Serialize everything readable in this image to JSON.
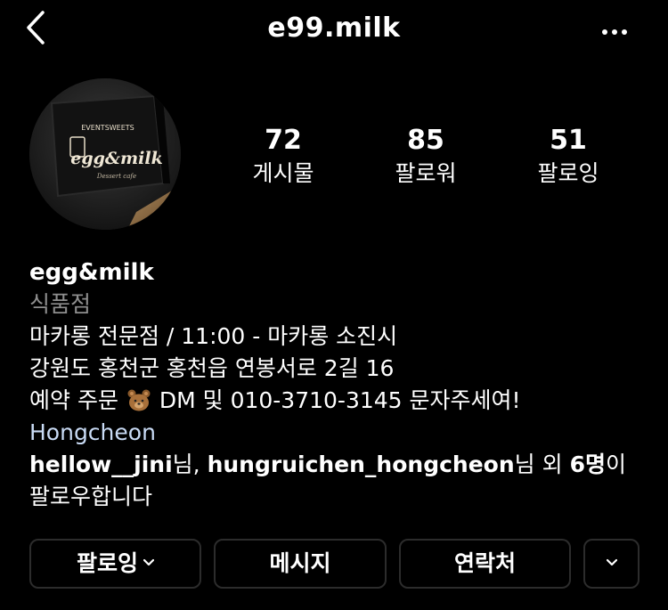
{
  "header": {
    "username": "e99.milk"
  },
  "avatar": {
    "sign_top": "EVENTSWEETS",
    "sign_brand": "egg&milk",
    "sign_sub": "Dessert cafe"
  },
  "stats": [
    {
      "value": "72",
      "label": "게시물"
    },
    {
      "value": "85",
      "label": "팔로워"
    },
    {
      "value": "51",
      "label": "팔로잉"
    }
  ],
  "bio": {
    "name": "egg&milk",
    "category": "식품점",
    "line1": "마카롱 전문점 / 11:00 - 마카롱 소진시",
    "line2": "강원도 홍천군 홍천읍 연봉서로 2길 16",
    "line3_before": "예약 주문 ",
    "line3_after": " DM 및 010-3710-3145 문자주세여!",
    "location": "Hongcheon",
    "followed_user1": "hellow__jini",
    "followed_sep1": "님, ",
    "followed_user2": "hungruichen_hongcheon",
    "followed_sep2": "님 외 ",
    "followed_count": "6명",
    "followed_tail": "이",
    "followed_line2": "팔로우합니다"
  },
  "buttons": {
    "following": "팔로잉",
    "message": "메시지",
    "contact": "연락처"
  },
  "icons": {
    "back": "chevron-left-icon",
    "more": "more-horizontal-icon",
    "bear": "teddy-bear-emoji",
    "dropdown": "chevron-down-icon"
  }
}
